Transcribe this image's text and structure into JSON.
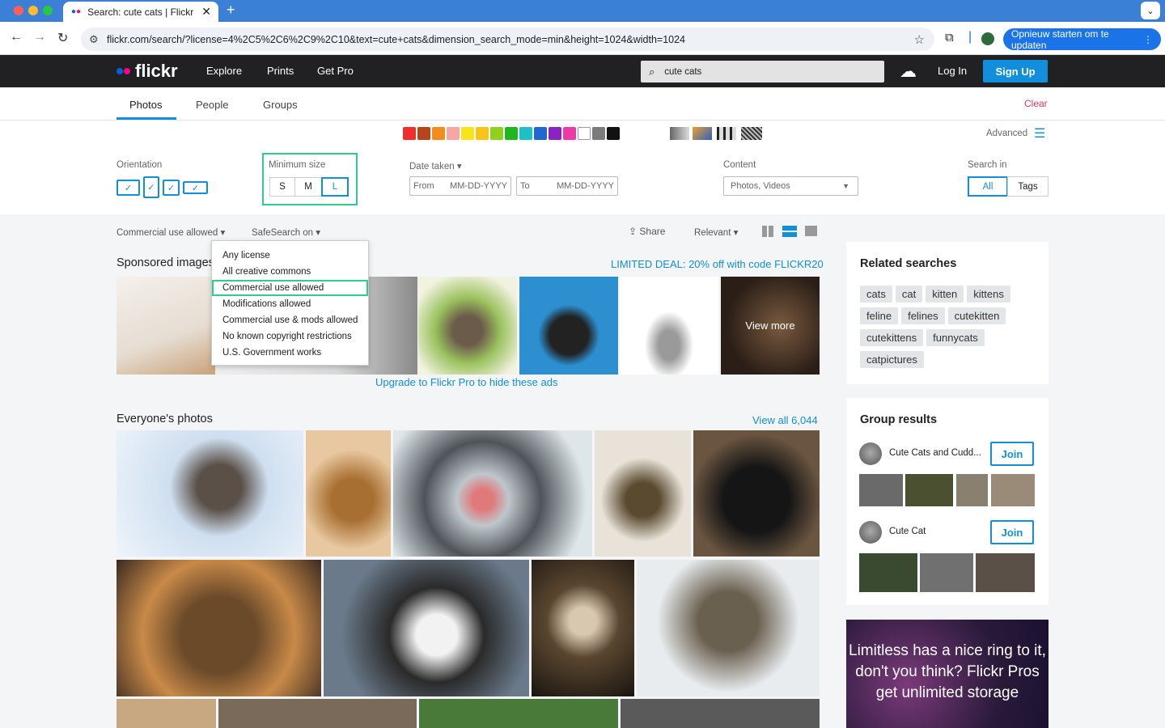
{
  "browser": {
    "tab_title": "Search: cute cats | Flickr",
    "url": "flickr.com/search/?license=4%2C5%2C6%2C9%2C10&text=cute+cats&dimension_search_mode=min&height=1024&width=1024",
    "update_label": "Opnieuw starten om te updaten"
  },
  "header": {
    "logo": "flickr",
    "nav": [
      "Explore",
      "Prints",
      "Get Pro"
    ],
    "search_value": "cute cats",
    "login": "Log In",
    "signup": "Sign Up"
  },
  "search_tabs": [
    "Photos",
    "People",
    "Groups"
  ],
  "clear": "Clear",
  "advanced": "Advanced",
  "colors": [
    "#ef2e2e",
    "#b5451b",
    "#f28c1c",
    "#f7a6a6",
    "#f7e41a",
    "#f7c51a",
    "#8fd11c",
    "#1fb71f",
    "#1ec0c7",
    "#2067cf",
    "#8c22c2",
    "#ec3aa6",
    "#ffffff",
    "#7b7b7b",
    "#111111"
  ],
  "filters": {
    "orientation_label": "Orientation",
    "min_size_label": "Minimum size",
    "sizes": [
      "S",
      "M",
      "L"
    ],
    "date_label": "Date taken",
    "from": "From",
    "to": "To",
    "date_placeholder": "MM-DD-YYYY",
    "content_label": "Content",
    "content_value": "Photos, Videos",
    "search_in_label": "Search in",
    "search_in": [
      "All",
      "Tags"
    ]
  },
  "toolbar": {
    "license": "Commercial use allowed",
    "safesearch": "SafeSearch on",
    "share": "Share",
    "sort": "Relevant"
  },
  "license_menu": [
    "Any license",
    "All creative commons",
    "Commercial use allowed",
    "Modifications allowed",
    "Commercial use & mods allowed",
    "No known copyright restrictions",
    "U.S. Government works"
  ],
  "sponsored": {
    "title": "Sponsored images",
    "deal": "LIMITED DEAL: 20% off with code FLICKR20",
    "view_more": "View more",
    "upgrade": "Upgrade to Flickr Pro to hide these ads"
  },
  "everyone": {
    "title": "Everyone's photos",
    "view_all": "View all 6,044"
  },
  "related": {
    "title": "Related searches",
    "tags": [
      "cats",
      "cat",
      "kitten",
      "kittens",
      "feline",
      "felines",
      "cutekitten",
      "cutekittens",
      "funnycats",
      "catpictures"
    ]
  },
  "groups": {
    "title": "Group results",
    "items": [
      {
        "name": "Cute Cats and Cudd...",
        "join": "Join"
      },
      {
        "name": "Cute Cat",
        "join": "Join"
      }
    ]
  },
  "promo": "Limitless has a nice ring to it, don't you think? Flickr Pros get unlimited storage"
}
